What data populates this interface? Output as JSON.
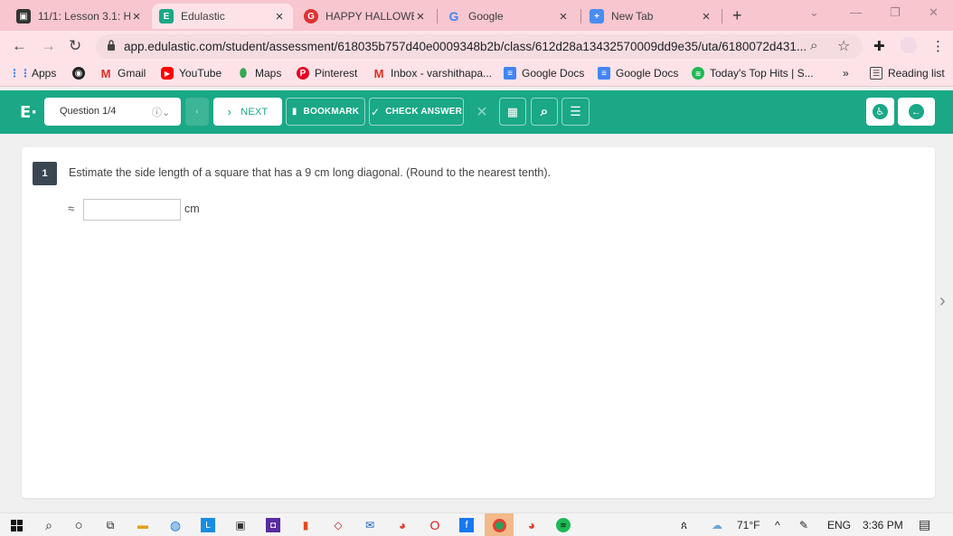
{
  "browser": {
    "tabs": [
      {
        "title": "11/1: Lesson 3.1: H",
        "active": false
      },
      {
        "title": "Edulastic",
        "active": true
      },
      {
        "title": "HAPPY HALLOWEE",
        "active": false
      },
      {
        "title": "Google",
        "active": false
      },
      {
        "title": "New Tab",
        "active": false
      }
    ],
    "url": "app.edulastic.com/student/assessment/618035b757d40e0009348b2b/class/612d28a13432570009dd9e35/uta/6180072d431...",
    "bookmarks": [
      {
        "label": "Apps",
        "icon": "apps-grid-icon"
      },
      {
        "label": "",
        "icon": "globe-icon"
      },
      {
        "label": "Gmail",
        "icon": "gmail-icon"
      },
      {
        "label": "YouTube",
        "icon": "youtube-icon"
      },
      {
        "label": "Maps",
        "icon": "maps-icon"
      },
      {
        "label": "Pinterest",
        "icon": "pinterest-icon"
      },
      {
        "label": "Inbox - varshithapa...",
        "icon": "gmail-icon"
      },
      {
        "label": "Google Docs",
        "icon": "docs-icon"
      },
      {
        "label": "Google Docs",
        "icon": "docs-icon"
      },
      {
        "label": "Today's Top Hits | S...",
        "icon": "spotify-icon"
      }
    ],
    "bookmarks_overflow": "»",
    "reading_list": "Reading list"
  },
  "app": {
    "logo": "E·",
    "question_select": "Question 1/4",
    "next_label": "NEXT",
    "bookmark_label": "BOOKMARK",
    "check_answer_label": "CHECK ANSWER",
    "accent_color": "#1aa886"
  },
  "question": {
    "number": "1",
    "text": "Estimate the side length of a square that has a 9 cm long diagonal. (Round to the nearest tenth).",
    "approx_symbol": "≈",
    "answer_value": "",
    "unit": "cm"
  },
  "taskbar": {
    "weather": "71°F",
    "language": "ENG",
    "time": "3:36 PM"
  }
}
